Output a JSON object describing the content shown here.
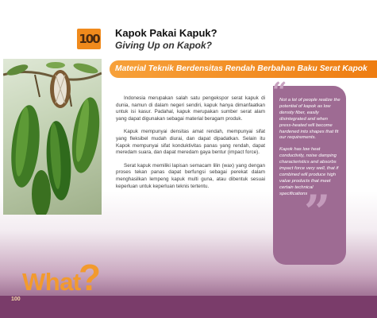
{
  "logo": {
    "text": "100"
  },
  "header": {
    "title": "Kapok Pakai Kapuk?",
    "subtitle": "Giving Up on Kapok?"
  },
  "banner": {
    "text": "Material Teknik Berdensitas Rendah Berbahan Baku Serat Kapok"
  },
  "body": {
    "paragraphs": [
      "Indonesia merupakan salah satu pengekspor serat kapuk di dunia, namun di dalam negeri sendiri, kapuk hanya dimanfaatkan untuk isi kasur. Padahal, kapuk merupakan sumber serat alam yang dapat digunakan sebagai material beragam produk.",
      "Kapuk mempunyai densitas amat rendah, mempunyai sifat yang fleksibel mudah diurai, dan dapat dipadatkan. Selain itu Kapok mempunyai sifat konduktivitas panas yang rendah, dapat meredam suara, dan dapat meredam gaya bentur (impact force).",
      "Serat kapuk memiliki lapisan semacam lilin (wax) yang dengan proses tekan panas dapat berfungsi sebagai perekat dalam menghasilkan lempeng kapuk multi guna, atau dibentuk sesuai keperluan untuk keperluan teknis tertentu."
    ]
  },
  "quote": {
    "paragraphs": [
      "Not a lot of people realize the potential of kapok as low density fiber, easily disintegrated and when press-heated will become hardened into shapes that fit our requirements.",
      "Kapok has low heat conductivity, noise damping characteristics and absorbs impact force very well, that if combined will produce high value products that meet certain technical specifications"
    ]
  },
  "footer": {
    "what_word": "What",
    "what_mark": "?",
    "page_number": "100"
  },
  "colors": {
    "accent_orange": "#f08a1c",
    "quote_purple": "#9e6b93",
    "footer_purple": "#7a3c6a"
  }
}
